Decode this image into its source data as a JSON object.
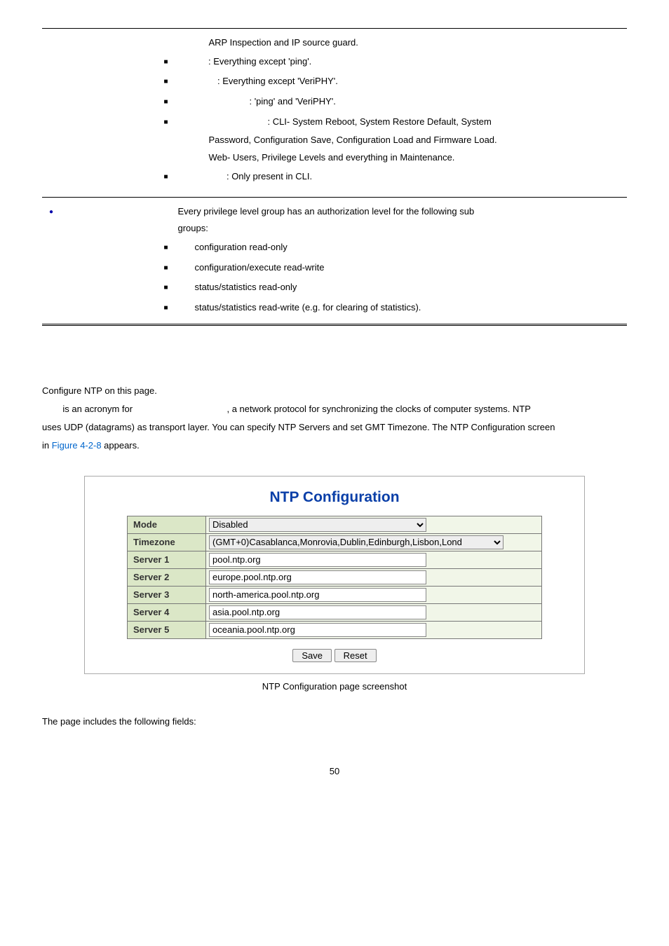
{
  "table1": {
    "arp_line": "ARP Inspection and IP source guard.",
    "items": [
      {
        "prefix": "",
        "suffix": ": Everything except 'ping'."
      },
      {
        "prefix": "",
        "suffix": ": Everything except 'VeriPHY'."
      },
      {
        "prefix": "",
        "suffix": ": 'ping' and 'VeriPHY'."
      },
      {
        "prefix": "",
        "suffix": ": CLI- System Reboot, System Restore Default, System"
      }
    ],
    "cont1": "Password, Configuration Save, Configuration Load and Firmware Load.",
    "cont2": "Web- Users, Privilege Levels and everything in Maintenance.",
    "last_item": ": Only present in CLI."
  },
  "table2": {
    "intro": "Every privilege level group has an authorization level for the following sub",
    "intro2": "groups:",
    "items": [
      "configuration read-only",
      "configuration/execute read-write",
      "status/statistics read-only",
      "status/statistics read-write (e.g. for clearing of statistics)."
    ]
  },
  "body": {
    "p1": "Configure NTP on this page.",
    "p2a": " is an acronym for ",
    "p2b": ", a network protocol for synchronizing the clocks of computer systems. NTP",
    "p3": "uses UDP (datagrams) as transport layer. You can specify NTP Servers and set GMT Timezone. The NTP Configuration screen",
    "p4a": "in ",
    "p4link": "Figure 4-2-8",
    "p4b": " appears."
  },
  "ntp": {
    "title": "NTP Configuration",
    "rows": {
      "mode_label": "Mode",
      "mode_value": "Disabled",
      "tz_label": "Timezone",
      "tz_value": "(GMT+0)Casablanca,Monrovia,Dublin,Edinburgh,Lisbon,Lond",
      "s1_label": "Server 1",
      "s1_value": "pool.ntp.org",
      "s2_label": "Server 2",
      "s2_value": "europe.pool.ntp.org",
      "s3_label": "Server 3",
      "s3_value": "north-america.pool.ntp.org",
      "s4_label": "Server 4",
      "s4_value": "asia.pool.ntp.org",
      "s5_label": "Server 5",
      "s5_value": "oceania.pool.ntp.org"
    },
    "save": "Save",
    "reset": "Reset"
  },
  "caption": " NTP Configuration page screenshot",
  "footer_line": "The page includes the following fields:",
  "page_num": "50"
}
